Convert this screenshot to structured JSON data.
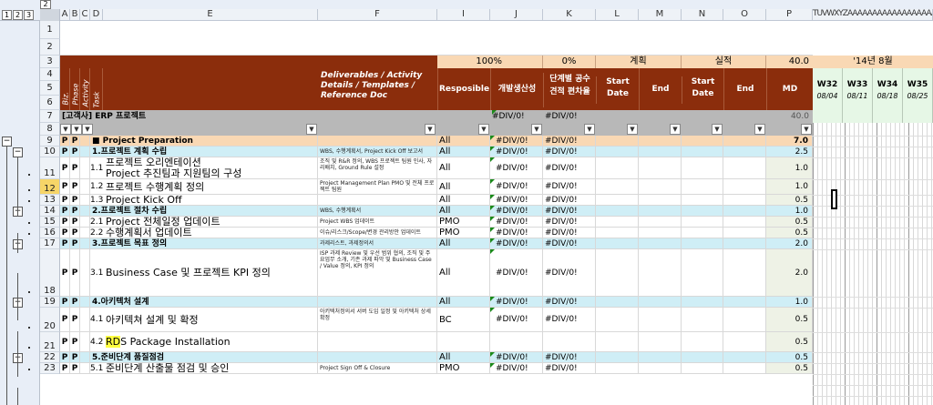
{
  "outline_levels": [
    "1",
    "2",
    "3"
  ],
  "top_level_label": "2",
  "columns": [
    "A",
    "B",
    "C",
    "D",
    "E",
    "F",
    "I",
    "J",
    "K",
    "L",
    "M",
    "N",
    "O",
    "P"
  ],
  "timeline_columns": "TUVWXYZAAAAAAAAAAAAAAAAAAAAAAA",
  "header": {
    "pct1": "100%",
    "pct2": "0%",
    "plan": "계획",
    "actual": "실적",
    "md_total": "40.0",
    "month": "'14년 8월",
    "deliverables": "Deliverables / Activity Details / Templates / Reference Doc",
    "resp": "Resposible",
    "dev_prod": "개발생산성",
    "stage_dev": "단계별 공수 견적 편차율",
    "start_date": "Start Date",
    "end_date": "End Date",
    "start_date2": "Start Date",
    "end_date2": "End Date",
    "md": "MD",
    "lv_biz": "Biz.",
    "lv_phase": "Phase",
    "lv_activity": "Activity",
    "lv_task": "Task"
  },
  "weeks": [
    {
      "w": "W32",
      "d": "08/04"
    },
    {
      "w": "W33",
      "d": "08/11"
    },
    {
      "w": "W34",
      "d": "08/18"
    },
    {
      "w": "W35",
      "d": "08/25"
    }
  ],
  "project_row": {
    "title": "[고객사] ERP 프로젝트",
    "j": "#DIV/0!",
    "k": "#DIV/0!",
    "p": "40.0"
  },
  "rows": [
    {
      "num": "9",
      "a": "P",
      "b": "P",
      "text": "■ Project Preparation",
      "f": "",
      "i": "All",
      "j": "#DIV/0!",
      "k": "#DIV/0!",
      "p": "7.0"
    },
    {
      "num": "10",
      "a": "P",
      "b": "P",
      "text": "1.프로젝트 계획 수립",
      "f": "WBS, 수행계획서, Project Kick Off 보고서",
      "i": "All",
      "j": "#DIV/0!",
      "k": "#DIV/0!",
      "p": "2.5"
    },
    {
      "num": "11",
      "a": "P",
      "b": "P",
      "d": "1.1.",
      "text": "프로젝트 오리엔테이션",
      "text2": "Project 추진팀과 지원팀의 구성",
      "f": "조직 및 R&R 정의, WBS 프로젝트 팀원 인사, 자리배치, Ground Rule 설정",
      "i": "All",
      "j": "#DIV/0!",
      "k": "#DIV/0!",
      "p": "1.0"
    },
    {
      "num": "12",
      "a": "P",
      "b": "P",
      "d": "1.2.",
      "text": "프로젝트 수행계획 정의",
      "f": "Project Management Plan PMO 및 전체 프로젝트 팀원",
      "i": "All",
      "j": "#DIV/0!",
      "k": "#DIV/0!",
      "p": "1.0"
    },
    {
      "num": "13",
      "a": "P",
      "b": "P",
      "d": "1.3.",
      "text": "Project Kick Off",
      "f": "",
      "i": "All",
      "j": "#DIV/0!",
      "k": "#DIV/0!",
      "p": "0.5"
    },
    {
      "num": "14",
      "a": "P",
      "b": "P",
      "text": "2.프로젝트 절차 수립",
      "f": "WBS, 수행계획서",
      "i": "All",
      "j": "#DIV/0!",
      "k": "#DIV/0!",
      "p": "1.0"
    },
    {
      "num": "15",
      "a": "P",
      "b": "P",
      "d": "2.1.",
      "text": "Project 전체일정 업데이트",
      "f": "Project WBS 업데이트",
      "i": "PMO",
      "j": "#DIV/0!",
      "k": "#DIV/0!",
      "p": "0.5"
    },
    {
      "num": "16",
      "a": "P",
      "b": "P",
      "d": "2.2.",
      "text": "수행계획서 업데이트",
      "f": "이슈/리스크/Scope/변경 관리방안 업데이트",
      "i": "PMO",
      "j": "#DIV/0!",
      "k": "#DIV/0!",
      "p": "0.5"
    },
    {
      "num": "17",
      "a": "P",
      "b": "P",
      "text": "3.프로젝트 목표 정의",
      "f": "과제리스트, 과제정의서",
      "i": "All",
      "j": "#DIV/0!",
      "k": "#DIV/0!",
      "p": "2.0"
    },
    {
      "num": "18",
      "a": "P",
      "b": "P",
      "d": "3.1.",
      "text": "Business Case 및 프로젝트 KPI 정의",
      "f": "ISP 과제 Review 및 우선 범위 협의, 조직 및 주요업무 소개, 기존 과제 파악 및 Business Case / Value 정의, KPI 정의",
      "i": "All",
      "j": "#DIV/0!",
      "k": "#DIV/0!",
      "p": "2.0"
    },
    {
      "num": "19",
      "a": "P",
      "b": "P",
      "text": "4.아키텍처 설계",
      "f": "",
      "i": "All",
      "j": "#DIV/0!",
      "k": "#DIV/0!",
      "p": "1.0"
    },
    {
      "num": "20",
      "a": "P",
      "b": "P",
      "d": "4.1.",
      "text": "아키텍쳐 설계 및 확정",
      "f": "아키텍처정의서 서버 도입 일정 및 아키텍처 상세 확정",
      "i": "BC",
      "j": "#DIV/0!",
      "k": "#DIV/0!",
      "p": "0.5"
    },
    {
      "num": "21",
      "a": "P",
      "b": "P",
      "d": "4.2.",
      "text": "RDS Package Installation",
      "f": "",
      "i": "",
      "j": "",
      "k": "",
      "p": "0.5"
    },
    {
      "num": "22",
      "a": "P",
      "b": "P",
      "text": "5.준비단계 품질점검",
      "f": "",
      "i": "All",
      "j": "#DIV/0!",
      "k": "#DIV/0!",
      "p": "0.5"
    },
    {
      "num": "23",
      "a": "P",
      "b": "P",
      "d": "5.1.",
      "text": "준비단계 산출물 점검 및 승인",
      "f": "Project Sign Off & Closure",
      "i": "PMO",
      "j": "#DIV/0!",
      "k": "#DIV/0!",
      "p": "0.5"
    }
  ]
}
